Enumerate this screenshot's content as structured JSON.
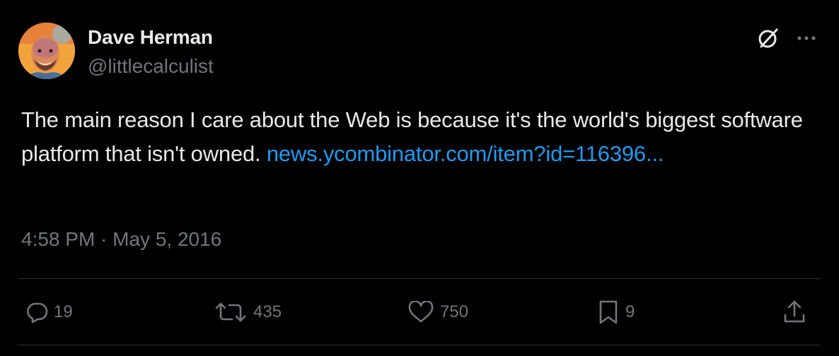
{
  "author": {
    "name": "Dave Herman",
    "handle": "@littlecalculist"
  },
  "tweet": {
    "text": "The main reason I care about the Web is because it's the world's biggest software platform that isn't owned. ",
    "link_text": "news.ycombinator.com/item?id=116396...",
    "timestamp": "4:58 PM · May 5, 2016"
  },
  "actions": {
    "replies": "19",
    "reposts": "435",
    "likes": "750",
    "bookmarks": "9"
  },
  "icons": {
    "grok": "grok-icon",
    "more": "more-icon",
    "reply": "reply-icon",
    "repost": "repost-icon",
    "like": "heart-icon",
    "bookmark": "bookmark-icon",
    "share": "share-icon"
  },
  "colors": {
    "background": "#000000",
    "primary_text": "#e7e9ea",
    "secondary_text": "#71767b",
    "link": "#1d9bf0",
    "divider": "#2f3336"
  }
}
